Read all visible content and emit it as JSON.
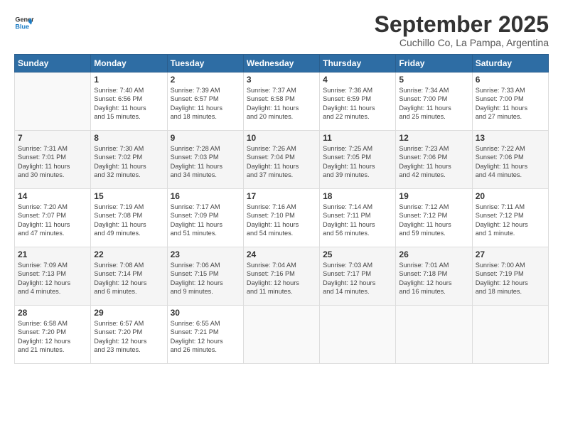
{
  "header": {
    "logo_line1": "General",
    "logo_line2": "Blue",
    "month_title": "September 2025",
    "subtitle": "Cuchillo Co, La Pampa, Argentina"
  },
  "weekdays": [
    "Sunday",
    "Monday",
    "Tuesday",
    "Wednesday",
    "Thursday",
    "Friday",
    "Saturday"
  ],
  "weeks": [
    [
      {
        "day": "",
        "info": ""
      },
      {
        "day": "1",
        "info": "Sunrise: 7:40 AM\nSunset: 6:56 PM\nDaylight: 11 hours\nand 15 minutes."
      },
      {
        "day": "2",
        "info": "Sunrise: 7:39 AM\nSunset: 6:57 PM\nDaylight: 11 hours\nand 18 minutes."
      },
      {
        "day": "3",
        "info": "Sunrise: 7:37 AM\nSunset: 6:58 PM\nDaylight: 11 hours\nand 20 minutes."
      },
      {
        "day": "4",
        "info": "Sunrise: 7:36 AM\nSunset: 6:59 PM\nDaylight: 11 hours\nand 22 minutes."
      },
      {
        "day": "5",
        "info": "Sunrise: 7:34 AM\nSunset: 7:00 PM\nDaylight: 11 hours\nand 25 minutes."
      },
      {
        "day": "6",
        "info": "Sunrise: 7:33 AM\nSunset: 7:00 PM\nDaylight: 11 hours\nand 27 minutes."
      }
    ],
    [
      {
        "day": "7",
        "info": "Sunrise: 7:31 AM\nSunset: 7:01 PM\nDaylight: 11 hours\nand 30 minutes."
      },
      {
        "day": "8",
        "info": "Sunrise: 7:30 AM\nSunset: 7:02 PM\nDaylight: 11 hours\nand 32 minutes."
      },
      {
        "day": "9",
        "info": "Sunrise: 7:28 AM\nSunset: 7:03 PM\nDaylight: 11 hours\nand 34 minutes."
      },
      {
        "day": "10",
        "info": "Sunrise: 7:26 AM\nSunset: 7:04 PM\nDaylight: 11 hours\nand 37 minutes."
      },
      {
        "day": "11",
        "info": "Sunrise: 7:25 AM\nSunset: 7:05 PM\nDaylight: 11 hours\nand 39 minutes."
      },
      {
        "day": "12",
        "info": "Sunrise: 7:23 AM\nSunset: 7:06 PM\nDaylight: 11 hours\nand 42 minutes."
      },
      {
        "day": "13",
        "info": "Sunrise: 7:22 AM\nSunset: 7:06 PM\nDaylight: 11 hours\nand 44 minutes."
      }
    ],
    [
      {
        "day": "14",
        "info": "Sunrise: 7:20 AM\nSunset: 7:07 PM\nDaylight: 11 hours\nand 47 minutes."
      },
      {
        "day": "15",
        "info": "Sunrise: 7:19 AM\nSunset: 7:08 PM\nDaylight: 11 hours\nand 49 minutes."
      },
      {
        "day": "16",
        "info": "Sunrise: 7:17 AM\nSunset: 7:09 PM\nDaylight: 11 hours\nand 51 minutes."
      },
      {
        "day": "17",
        "info": "Sunrise: 7:16 AM\nSunset: 7:10 PM\nDaylight: 11 hours\nand 54 minutes."
      },
      {
        "day": "18",
        "info": "Sunrise: 7:14 AM\nSunset: 7:11 PM\nDaylight: 11 hours\nand 56 minutes."
      },
      {
        "day": "19",
        "info": "Sunrise: 7:12 AM\nSunset: 7:12 PM\nDaylight: 11 hours\nand 59 minutes."
      },
      {
        "day": "20",
        "info": "Sunrise: 7:11 AM\nSunset: 7:12 PM\nDaylight: 12 hours\nand 1 minute."
      }
    ],
    [
      {
        "day": "21",
        "info": "Sunrise: 7:09 AM\nSunset: 7:13 PM\nDaylight: 12 hours\nand 4 minutes."
      },
      {
        "day": "22",
        "info": "Sunrise: 7:08 AM\nSunset: 7:14 PM\nDaylight: 12 hours\nand 6 minutes."
      },
      {
        "day": "23",
        "info": "Sunrise: 7:06 AM\nSunset: 7:15 PM\nDaylight: 12 hours\nand 9 minutes."
      },
      {
        "day": "24",
        "info": "Sunrise: 7:04 AM\nSunset: 7:16 PM\nDaylight: 12 hours\nand 11 minutes."
      },
      {
        "day": "25",
        "info": "Sunrise: 7:03 AM\nSunset: 7:17 PM\nDaylight: 12 hours\nand 14 minutes."
      },
      {
        "day": "26",
        "info": "Sunrise: 7:01 AM\nSunset: 7:18 PM\nDaylight: 12 hours\nand 16 minutes."
      },
      {
        "day": "27",
        "info": "Sunrise: 7:00 AM\nSunset: 7:19 PM\nDaylight: 12 hours\nand 18 minutes."
      }
    ],
    [
      {
        "day": "28",
        "info": "Sunrise: 6:58 AM\nSunset: 7:20 PM\nDaylight: 12 hours\nand 21 minutes."
      },
      {
        "day": "29",
        "info": "Sunrise: 6:57 AM\nSunset: 7:20 PM\nDaylight: 12 hours\nand 23 minutes."
      },
      {
        "day": "30",
        "info": "Sunrise: 6:55 AM\nSunset: 7:21 PM\nDaylight: 12 hours\nand 26 minutes."
      },
      {
        "day": "",
        "info": ""
      },
      {
        "day": "",
        "info": ""
      },
      {
        "day": "",
        "info": ""
      },
      {
        "day": "",
        "info": ""
      }
    ]
  ]
}
